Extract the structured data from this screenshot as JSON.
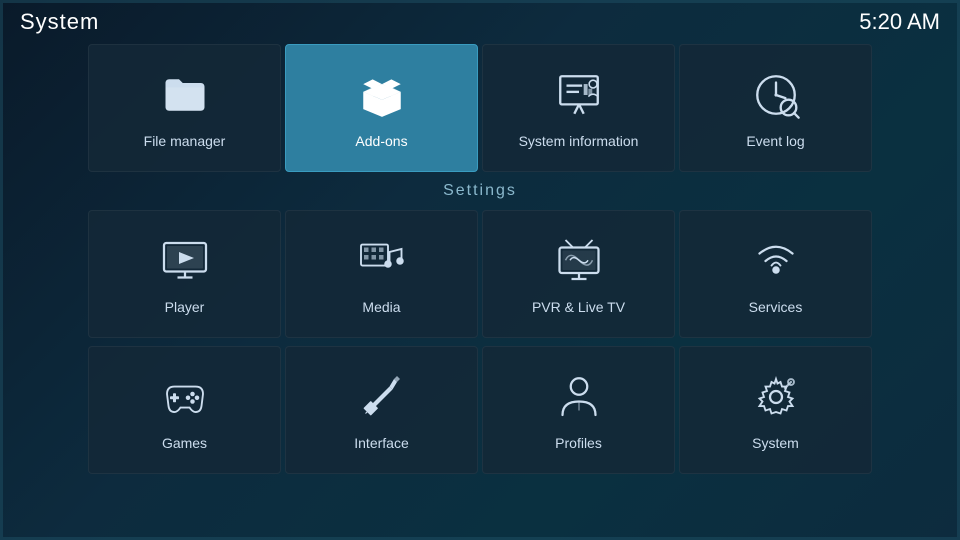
{
  "header": {
    "app_title": "System",
    "clock": "5:20 AM"
  },
  "top_tiles": [
    {
      "id": "file-manager",
      "label": "File manager",
      "icon": "folder",
      "active": false
    },
    {
      "id": "add-ons",
      "label": "Add-ons",
      "icon": "addons",
      "active": true
    },
    {
      "id": "system-information",
      "label": "System information",
      "icon": "sysinfo",
      "active": false
    },
    {
      "id": "event-log",
      "label": "Event log",
      "icon": "eventlog",
      "active": false
    }
  ],
  "settings_header": "Settings",
  "settings_tiles": [
    {
      "id": "player",
      "label": "Player",
      "icon": "player",
      "active": false
    },
    {
      "id": "media",
      "label": "Media",
      "icon": "media",
      "active": false
    },
    {
      "id": "pvr-live-tv",
      "label": "PVR & Live TV",
      "icon": "pvr",
      "active": false
    },
    {
      "id": "services",
      "label": "Services",
      "icon": "services",
      "active": false
    }
  ],
  "settings_tiles2": [
    {
      "id": "games",
      "label": "Games",
      "icon": "games",
      "active": false
    },
    {
      "id": "interface",
      "label": "Interface",
      "icon": "interface",
      "active": false
    },
    {
      "id": "profiles",
      "label": "Profiles",
      "icon": "profiles",
      "active": false
    },
    {
      "id": "system",
      "label": "System",
      "icon": "system",
      "active": false
    }
  ]
}
